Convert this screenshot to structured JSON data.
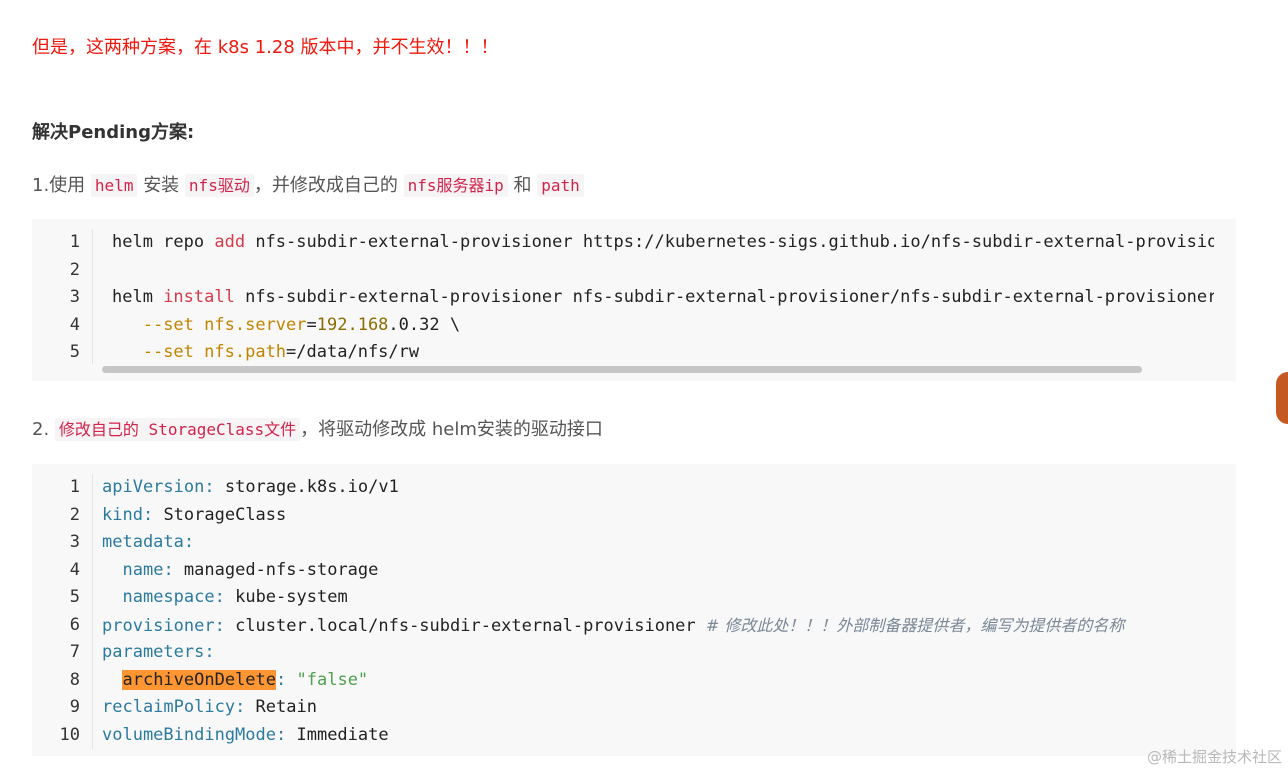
{
  "warning_text": "但是，这两种方案，在 k8s 1.28 版本中，并不生效！！！",
  "subheading": "解决Pending方案:",
  "step1": {
    "prefix": "1.使用",
    "code1": "helm",
    "text2": "安装",
    "code2": "nfs驱动",
    "text3": "，并修改成自己的",
    "code3": "nfs服务器ip",
    "text4": "和",
    "code4": "path"
  },
  "step2": {
    "prefix": "2.",
    "code1": "修改自己的 StorageClass文件",
    "text2": "，将驱动修改成 helm安装的驱动接口"
  },
  "code_block_1": {
    "line_numbers": [
      "1",
      "2",
      "3",
      "4",
      "5"
    ],
    "lines": [
      {
        "t1": "helm repo ",
        "k1": "add",
        "t2": " nfs-subdir-external-provisioner https://kubernetes-sigs.github.io/nfs-subdir-external-provisioner/"
      },
      {},
      {
        "t1": "helm ",
        "k1": "install",
        "t2": " nfs-subdir-external-provisioner nfs-subdir-external-provisioner/nfs-subdir-external-provisioner \\"
      },
      {
        "indent": "   ",
        "o1": "--set",
        "sp": " ",
        "o2": "nfs.server",
        "eq": "=",
        "n1": "192.168",
        "t1": ".0.32 \\"
      },
      {
        "indent": "   ",
        "o1": "--set",
        "sp": " ",
        "o2": "nfs.path",
        "eq": "=",
        "t1": "/data/nfs/rw"
      }
    ]
  },
  "code_block_2": {
    "line_numbers": [
      "1",
      "2",
      "3",
      "4",
      "5",
      "6",
      "7",
      "8",
      "9",
      "10"
    ],
    "lines": [
      {
        "key": "apiVersion",
        "colon": ":",
        "val": " storage.k8s.io/v1"
      },
      {
        "key": "kind",
        "colon": ":",
        "val": " StorageClass"
      },
      {
        "key": "metadata",
        "colon": ":"
      },
      {
        "indent": "  ",
        "key": "name",
        "colon": ":",
        "val": " managed-nfs-storage"
      },
      {
        "indent": "  ",
        "key": "namespace",
        "colon": ":",
        "val": " kube-system"
      },
      {
        "key": "provisioner",
        "colon": ":",
        "val": " cluster.local/nfs-subdir-external-provisioner ",
        "comment": "# 修改此处！！！外部制备器提供者，编写为提供者的名称"
      },
      {
        "key": "parameters",
        "colon": ":"
      },
      {
        "indent": "  ",
        "hl_key": "archiveOnDelete",
        "colon": ":",
        "sp": " ",
        "str": "\"false\""
      },
      {
        "key": "reclaimPolicy",
        "colon": ":",
        "val": " Retain"
      },
      {
        "key": "volumeBindingMode",
        "colon": ":",
        "val": " Immediate"
      }
    ]
  },
  "watermark": "@稀土掘金技术社区",
  "colors": {
    "warning": "#f0180d",
    "inline_code": "#d1234c",
    "yaml_key": "#2b7aa0",
    "string": "#50a14f",
    "highlight": "#ff9632"
  }
}
